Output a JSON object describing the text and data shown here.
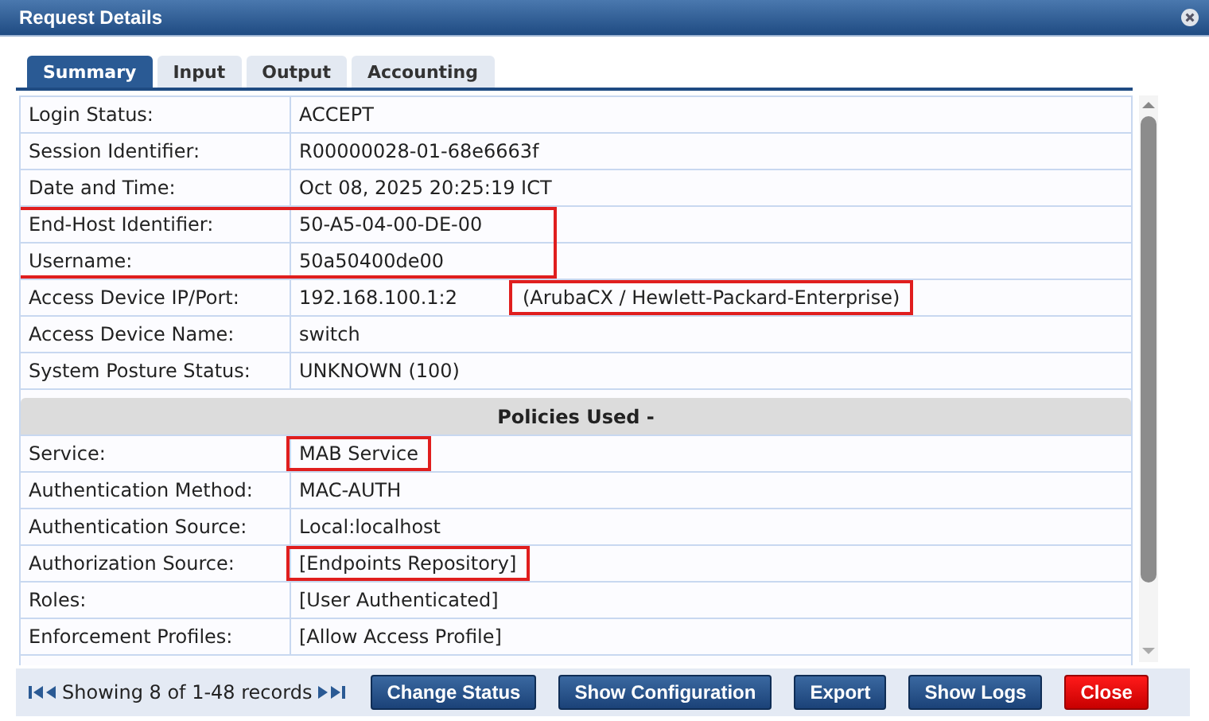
{
  "window": {
    "title": "Request Details"
  },
  "tabs": [
    {
      "label": "Summary",
      "selected": true
    },
    {
      "label": "Input",
      "selected": false
    },
    {
      "label": "Output",
      "selected": false
    },
    {
      "label": "Accounting",
      "selected": false
    }
  ],
  "rows": [
    {
      "kind": "field",
      "label": "Login Status:",
      "value": "ACCEPT",
      "row_boxed": false,
      "value_boxed": false
    },
    {
      "kind": "field",
      "label": "Session Identifier:",
      "value": "R00000028-01-68e6663f",
      "row_boxed": false,
      "value_boxed": false
    },
    {
      "kind": "field",
      "label": "Date and Time:",
      "value": "Oct 08, 2025 20:25:19 ICT",
      "row_boxed": false,
      "value_boxed": false
    },
    {
      "kind": "field",
      "label": "End-Host Identifier:",
      "value": "50-A5-04-00-DE-00",
      "row_boxed": true,
      "value_boxed": false
    },
    {
      "kind": "field",
      "label": "Username:",
      "value": "50a50400de00",
      "row_boxed": true,
      "value_boxed": false
    },
    {
      "kind": "field",
      "label": "Access Device IP/Port:",
      "value": "192.168.100.1:2",
      "extra": "(ArubaCX / Hewlett-Packard-Enterprise)",
      "row_boxed": false,
      "value_boxed": false,
      "extra_boxed": true
    },
    {
      "kind": "field",
      "label": "Access Device Name:",
      "value": "switch",
      "row_boxed": false,
      "value_boxed": false
    },
    {
      "kind": "field",
      "label": "System Posture Status:",
      "value": "UNKNOWN (100)",
      "row_boxed": false,
      "value_boxed": false
    },
    {
      "kind": "header",
      "label": "Policies Used -"
    },
    {
      "kind": "field",
      "label": "Service:",
      "value": "MAB Service",
      "row_boxed": false,
      "value_boxed": true
    },
    {
      "kind": "field",
      "label": "Authentication Method:",
      "value": "MAC-AUTH",
      "row_boxed": false,
      "value_boxed": false
    },
    {
      "kind": "field",
      "label": "Authentication Source:",
      "value": "Local:localhost",
      "row_boxed": false,
      "value_boxed": false
    },
    {
      "kind": "field",
      "label": "Authorization Source:",
      "value": "[Endpoints Repository]",
      "row_boxed": false,
      "value_boxed": true
    },
    {
      "kind": "field",
      "label": "Roles:",
      "value": "[User Authenticated]",
      "row_boxed": false,
      "value_boxed": false
    },
    {
      "kind": "field",
      "label": "Enforcement Profiles:",
      "value": "[Allow Access Profile]",
      "row_boxed": false,
      "value_boxed": false
    }
  ],
  "pager": {
    "text": "Showing 8 of 1-48 records"
  },
  "buttons": [
    {
      "label": "Change Status",
      "kind": "primary"
    },
    {
      "label": "Show Configuration",
      "kind": "primary"
    },
    {
      "label": "Export",
      "kind": "primary"
    },
    {
      "label": "Show Logs",
      "kind": "primary"
    },
    {
      "label": "Close",
      "kind": "danger"
    }
  ]
}
